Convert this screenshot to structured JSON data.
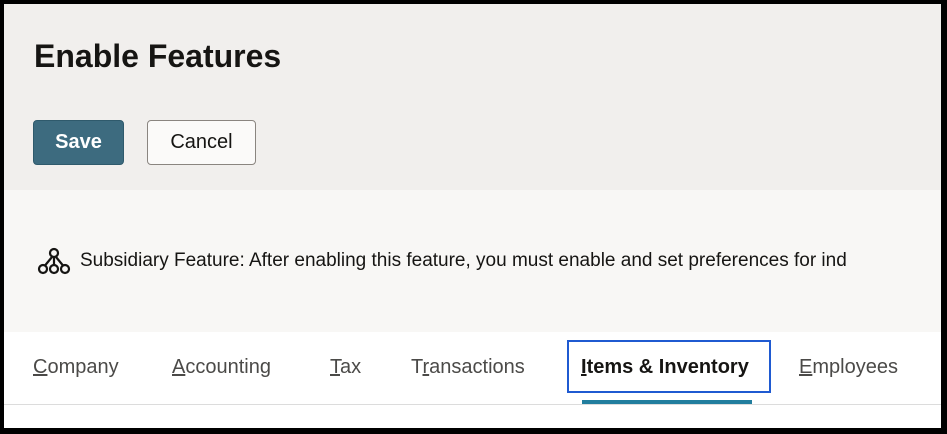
{
  "page": {
    "title": "Enable Features"
  },
  "actions": {
    "save_label": "Save",
    "cancel_label": "Cancel"
  },
  "notice": {
    "icon": "subsidiary-network-icon",
    "text": "Subsidiary Feature: After enabling this feature, you must enable and set preferences for ind"
  },
  "tabs": {
    "selected": "Items & Inventory",
    "items": [
      {
        "mnemonic": "C",
        "rest": "ompany"
      },
      {
        "mnemonic": "A",
        "rest": "ccounting"
      },
      {
        "mnemonic": "T",
        "rest": "ax"
      },
      {
        "first": "T",
        "mnemonic": "r",
        "rest": "ansactions"
      },
      {
        "mnemonic": "I",
        "rest": "tems & Inventory"
      },
      {
        "mnemonic": "E",
        "rest": "mployees"
      }
    ]
  },
  "colors": {
    "header_bg": "#f1efed",
    "notice_bg": "#f8f7f5",
    "save_button": "#3d6b7f",
    "active_tab_indicator": "#227e9e",
    "focus_ring": "#1f5ad1"
  }
}
